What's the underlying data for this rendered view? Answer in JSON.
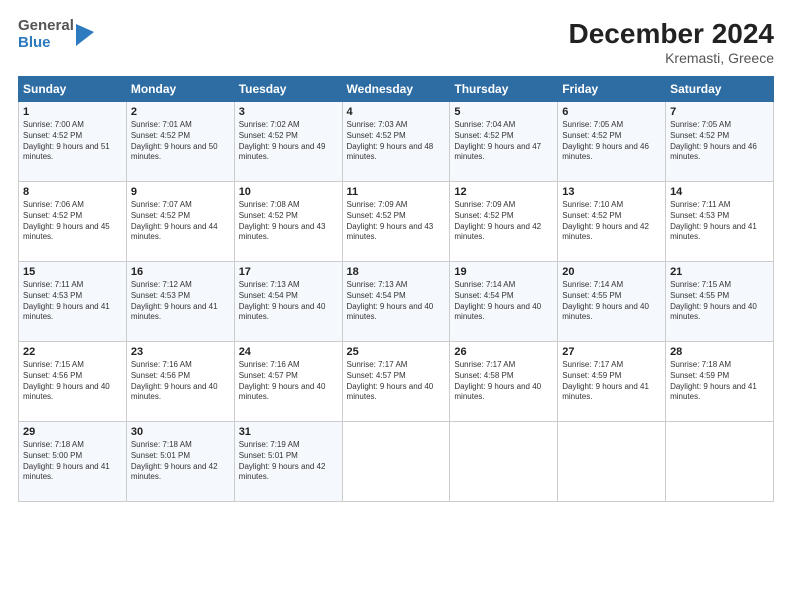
{
  "logo": {
    "line1": "General",
    "line2": "Blue"
  },
  "title": "December 2024",
  "subtitle": "Kremasti, Greece",
  "days_of_week": [
    "Sunday",
    "Monday",
    "Tuesday",
    "Wednesday",
    "Thursday",
    "Friday",
    "Saturday"
  ],
  "weeks": [
    [
      {
        "day": "1",
        "sunrise": "7:00 AM",
        "sunset": "4:52 PM",
        "daylight": "9 hours and 51 minutes."
      },
      {
        "day": "2",
        "sunrise": "7:01 AM",
        "sunset": "4:52 PM",
        "daylight": "9 hours and 50 minutes."
      },
      {
        "day": "3",
        "sunrise": "7:02 AM",
        "sunset": "4:52 PM",
        "daylight": "9 hours and 49 minutes."
      },
      {
        "day": "4",
        "sunrise": "7:03 AM",
        "sunset": "4:52 PM",
        "daylight": "9 hours and 48 minutes."
      },
      {
        "day": "5",
        "sunrise": "7:04 AM",
        "sunset": "4:52 PM",
        "daylight": "9 hours and 47 minutes."
      },
      {
        "day": "6",
        "sunrise": "7:05 AM",
        "sunset": "4:52 PM",
        "daylight": "9 hours and 46 minutes."
      },
      {
        "day": "7",
        "sunrise": "7:05 AM",
        "sunset": "4:52 PM",
        "daylight": "9 hours and 46 minutes."
      }
    ],
    [
      {
        "day": "8",
        "sunrise": "7:06 AM",
        "sunset": "4:52 PM",
        "daylight": "9 hours and 45 minutes."
      },
      {
        "day": "9",
        "sunrise": "7:07 AM",
        "sunset": "4:52 PM",
        "daylight": "9 hours and 44 minutes."
      },
      {
        "day": "10",
        "sunrise": "7:08 AM",
        "sunset": "4:52 PM",
        "daylight": "9 hours and 43 minutes."
      },
      {
        "day": "11",
        "sunrise": "7:09 AM",
        "sunset": "4:52 PM",
        "daylight": "9 hours and 43 minutes."
      },
      {
        "day": "12",
        "sunrise": "7:09 AM",
        "sunset": "4:52 PM",
        "daylight": "9 hours and 42 minutes."
      },
      {
        "day": "13",
        "sunrise": "7:10 AM",
        "sunset": "4:52 PM",
        "daylight": "9 hours and 42 minutes."
      },
      {
        "day": "14",
        "sunrise": "7:11 AM",
        "sunset": "4:53 PM",
        "daylight": "9 hours and 41 minutes."
      }
    ],
    [
      {
        "day": "15",
        "sunrise": "7:11 AM",
        "sunset": "4:53 PM",
        "daylight": "9 hours and 41 minutes."
      },
      {
        "day": "16",
        "sunrise": "7:12 AM",
        "sunset": "4:53 PM",
        "daylight": "9 hours and 41 minutes."
      },
      {
        "day": "17",
        "sunrise": "7:13 AM",
        "sunset": "4:54 PM",
        "daylight": "9 hours and 40 minutes."
      },
      {
        "day": "18",
        "sunrise": "7:13 AM",
        "sunset": "4:54 PM",
        "daylight": "9 hours and 40 minutes."
      },
      {
        "day": "19",
        "sunrise": "7:14 AM",
        "sunset": "4:54 PM",
        "daylight": "9 hours and 40 minutes."
      },
      {
        "day": "20",
        "sunrise": "7:14 AM",
        "sunset": "4:55 PM",
        "daylight": "9 hours and 40 minutes."
      },
      {
        "day": "21",
        "sunrise": "7:15 AM",
        "sunset": "4:55 PM",
        "daylight": "9 hours and 40 minutes."
      }
    ],
    [
      {
        "day": "22",
        "sunrise": "7:15 AM",
        "sunset": "4:56 PM",
        "daylight": "9 hours and 40 minutes."
      },
      {
        "day": "23",
        "sunrise": "7:16 AM",
        "sunset": "4:56 PM",
        "daylight": "9 hours and 40 minutes."
      },
      {
        "day": "24",
        "sunrise": "7:16 AM",
        "sunset": "4:57 PM",
        "daylight": "9 hours and 40 minutes."
      },
      {
        "day": "25",
        "sunrise": "7:17 AM",
        "sunset": "4:57 PM",
        "daylight": "9 hours and 40 minutes."
      },
      {
        "day": "26",
        "sunrise": "7:17 AM",
        "sunset": "4:58 PM",
        "daylight": "9 hours and 40 minutes."
      },
      {
        "day": "27",
        "sunrise": "7:17 AM",
        "sunset": "4:59 PM",
        "daylight": "9 hours and 41 minutes."
      },
      {
        "day": "28",
        "sunrise": "7:18 AM",
        "sunset": "4:59 PM",
        "daylight": "9 hours and 41 minutes."
      }
    ],
    [
      {
        "day": "29",
        "sunrise": "7:18 AM",
        "sunset": "5:00 PM",
        "daylight": "9 hours and 41 minutes."
      },
      {
        "day": "30",
        "sunrise": "7:18 AM",
        "sunset": "5:01 PM",
        "daylight": "9 hours and 42 minutes."
      },
      {
        "day": "31",
        "sunrise": "7:19 AM",
        "sunset": "5:01 PM",
        "daylight": "9 hours and 42 minutes."
      },
      null,
      null,
      null,
      null
    ]
  ]
}
